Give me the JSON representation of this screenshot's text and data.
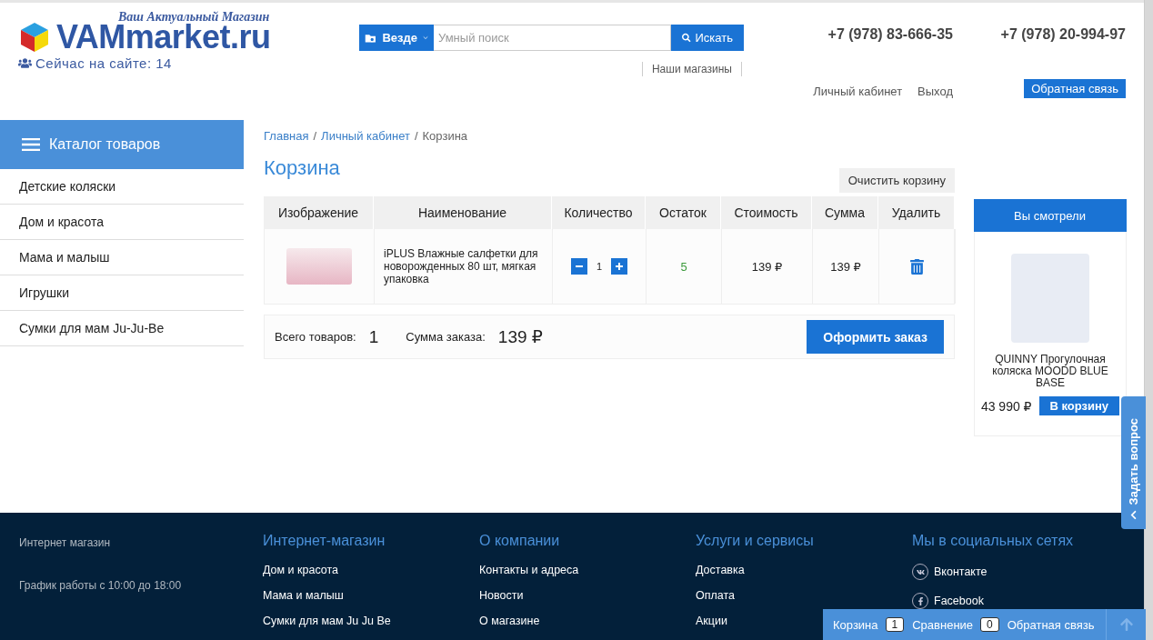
{
  "header": {
    "tagline": "Ваш Актуальный Магазин",
    "logo_text": "VAMmarket.ru",
    "online": "Сейчас на сайте: 14",
    "search": {
      "scope": "Везде",
      "placeholder": "Умный поиск",
      "button": "Искать"
    },
    "shops_link": "Наши магазины",
    "phones": [
      "+7 (978) 83-666-35",
      "+7 (978) 20-994-97"
    ],
    "account_links": [
      "Личный кабинет",
      "Выход"
    ],
    "feedback_button": "Обратная связь"
  },
  "sidebar": {
    "title": "Каталог товаров",
    "items": [
      {
        "label": "Детские коляски"
      },
      {
        "label": "Дом и красота"
      },
      {
        "label": "Мама и малыш"
      },
      {
        "label": "Игрушки"
      },
      {
        "label": "Сумки для мам Ju-Ju-Be"
      }
    ]
  },
  "breadcrumbs": [
    {
      "label": "Главная",
      "kind": "link"
    },
    {
      "label": "/",
      "kind": "separator"
    },
    {
      "label": "Личный кабинет",
      "kind": "link"
    },
    {
      "label": "/",
      "kind": "separator"
    },
    {
      "label": "Корзина",
      "kind": "current"
    }
  ],
  "page_title": "Корзина",
  "clear_button": "Очистить корзину",
  "table": {
    "columns": [
      "Изображение",
      "Наименование",
      "Количество",
      "Остаток",
      "Стоимость",
      "Сумма",
      "Удалить"
    ],
    "rows": [
      {
        "name": "iPLUS Влажные салфетки для новорожденных 80 шт, мягкая упаковка",
        "quantity": "1",
        "stock": "5",
        "price": "139 ₽",
        "sum": "139 ₽"
      }
    ]
  },
  "summary": {
    "items_label": "Всего товаров:",
    "items_count": "1",
    "total_label": "Сумма заказа:",
    "total": "139 ₽",
    "checkout_button": "Оформить заказ"
  },
  "viewed": {
    "title": "Вы смотрели",
    "product": {
      "name": "QUINNY Прогулочная коляска MOODD BLUE BASE",
      "price": "43 990 ₽",
      "button": "В корзину"
    }
  },
  "ask_tab": "Задать вопрос",
  "footer": {
    "info": [
      "Интернет магазин",
      "График работы с 10:00 до 18:00"
    ],
    "columns": [
      {
        "title": "Интернет-магазин",
        "links": [
          {
            "label": "Дом и красота",
            "kind": "text"
          },
          {
            "label": "Мама и малыш",
            "kind": "text"
          },
          {
            "label": "Сумки для мам Ju Ju Be",
            "kind": "text"
          }
        ]
      },
      {
        "title": "О компании",
        "links": [
          {
            "label": "Контакты и адреса",
            "kind": "text"
          },
          {
            "label": "Новости",
            "kind": "text"
          },
          {
            "label": "О магазине",
            "kind": "text"
          }
        ]
      },
      {
        "title": "Услуги и сервисы",
        "links": [
          {
            "label": "Доставка",
            "kind": "text"
          },
          {
            "label": "Оплата",
            "kind": "text"
          },
          {
            "label": "Акции",
            "kind": "text"
          }
        ]
      },
      {
        "title": "Мы в социальных сетях",
        "links": [
          {
            "label": "Вконтакте",
            "kind": "vk"
          },
          {
            "label": "Facebook",
            "kind": "facebook"
          }
        ]
      }
    ]
  },
  "bottom_bar": [
    {
      "label": "Корзина",
      "count": "1"
    },
    {
      "label": "Сравнение",
      "count": "0"
    },
    {
      "label": "Обратная связь"
    }
  ]
}
